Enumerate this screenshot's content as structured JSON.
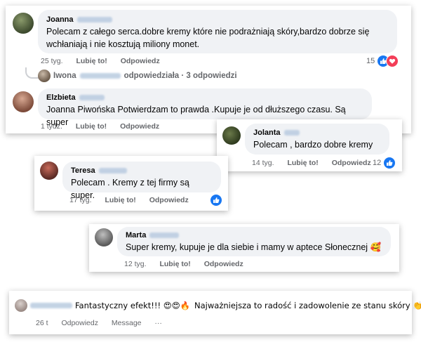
{
  "comments": [
    {
      "author": "Joanna",
      "text_line1": "Polecam z całego serca.dobre kremy które nie podrażniają skóry,bardzo dobrze się",
      "text_line2": "wchłaniają i nie kosztują miliony monet.",
      "time": "25 tyg.",
      "like": "Lubię to!",
      "reply": "Odpowiedz",
      "reaction_count": "15",
      "replies_author": "Iwona",
      "replies_text": "odpowiedziała · 3 odpowiedzi"
    },
    {
      "author": "Elzbieta",
      "text": "Joanna Piwońska Potwierdzam to prawda .Kupuje je od dłuższego czasu. Są super",
      "time": "1 tydz.",
      "like": "Lubię to!",
      "reply": "Odpowiedz"
    },
    {
      "author": "Jolanta",
      "text": "Polecam , bardzo dobre kremy",
      "time": "14 tyg.",
      "like": "Lubię to!",
      "reply": "Odpowiedz",
      "reaction_count": "12"
    },
    {
      "author": "Teresa",
      "text": "Polecam . Kremy z tej firmy są super.",
      "time": "17 tyg.",
      "like": "Lubię to!",
      "reply": "Odpowiedz"
    },
    {
      "author": "Marta",
      "text": "Super kremy, kupuje je dla siebie i mamy w aptece Słonecznej 🥰",
      "time": "12 tyg.",
      "like": "Lubię to!",
      "reply": "Odpowiedz"
    },
    {
      "text_a": "Fantastyczny efekt!!! 😍😍🔥",
      "text_b": "Najważniejsza to radość i zadowolenie ze stanu skóry 👏🔥",
      "time": "26 t",
      "reply": "Odpowiedz",
      "message": "Message",
      "more": "···"
    }
  ],
  "colors": {
    "like_blue": "#1877f2",
    "heart_red": "#f33e58",
    "meta_gray": "#65676b",
    "bubble": "#f0f2f5"
  },
  "icons": [
    "like-icon",
    "heart-icon"
  ]
}
